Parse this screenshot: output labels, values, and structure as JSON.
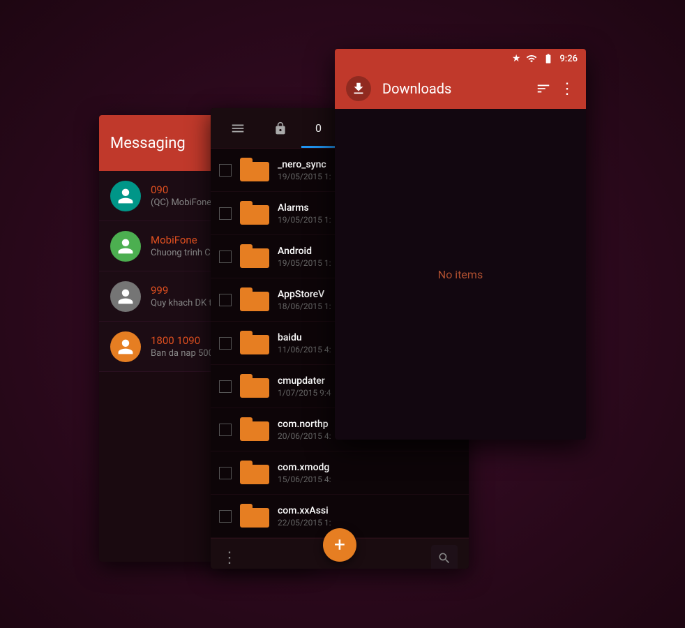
{
  "background": {
    "color": "#2a0a1a"
  },
  "messaging": {
    "title": "Messaging",
    "contacts": [
      {
        "id": 1,
        "name": "090",
        "subtitle": "(QC) MobiFone",
        "avatar_color": "teal",
        "preview": "(QC) MobiFone"
      },
      {
        "id": 2,
        "name": "MobiFone",
        "subtitle": "Chuong trinh CS",
        "avatar_color": "green",
        "preview": "Chuong trinh CS"
      },
      {
        "id": 3,
        "name": "999",
        "subtitle": "Quy khach DK t",
        "avatar_color": "grey",
        "preview": "Quy khach DK t"
      },
      {
        "id": 4,
        "name": "1800 1090",
        "subtitle": "Ban da nap 500",
        "avatar_color": "orange",
        "preview": "Ban da nap 500"
      }
    ]
  },
  "filemanager": {
    "tabs": [
      {
        "label": "☰",
        "active": false
      },
      {
        "label": "🔒",
        "active": false
      },
      {
        "label": "0",
        "active": true
      }
    ],
    "files": [
      {
        "name": "_nero_sync",
        "date": "19/05/2015 1:"
      },
      {
        "name": "Alarms",
        "date": "19/05/2015 1:"
      },
      {
        "name": "Android",
        "date": "19/05/2015 1:"
      },
      {
        "name": "AppStoreV",
        "date": "18/06/2015 1:"
      },
      {
        "name": "baidu",
        "date": "11/06/2015 4:"
      },
      {
        "name": "cmupdater",
        "date": "1/07/2015 9:4"
      },
      {
        "name": "com.northp",
        "date": "20/06/2015 4:"
      },
      {
        "name": "com.xmodg",
        "date": "15/06/2015 4:"
      },
      {
        "name": "com.xxAssi",
        "date": "22/05/2015 1:"
      }
    ],
    "bottom_icons": {
      "more": "⋮",
      "search": "🔍"
    },
    "fab_label": "+"
  },
  "downloads": {
    "status_bar": {
      "star": "★",
      "signal": "📶",
      "time": "9:26"
    },
    "header": {
      "title": "Downloads",
      "sort_icon": "≡",
      "more_icon": "⋮"
    },
    "empty_message": "No items",
    "filter_icon_label": "≡",
    "more_icon_label": "⋮"
  }
}
